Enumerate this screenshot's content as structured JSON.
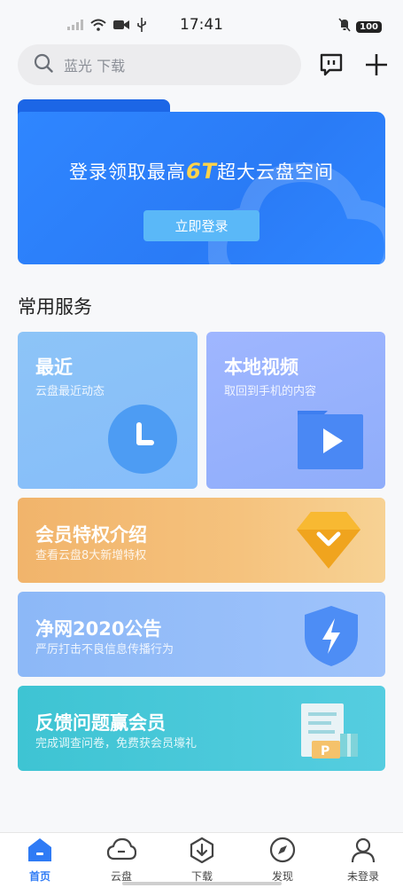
{
  "status_bar": {
    "time": "17:41",
    "battery": "100"
  },
  "search": {
    "placeholder": "蓝光 下载"
  },
  "banner": {
    "title_prefix": "登录领取最高",
    "title_highlight": "6T",
    "title_suffix": "超大云盘空间",
    "login_label": "立即登录"
  },
  "services": {
    "section_title": "常用服务",
    "recent": {
      "title": "最近",
      "subtitle": "云盘最近动态"
    },
    "local_video": {
      "title": "本地视频",
      "subtitle": "取回到手机的内容"
    },
    "vip": {
      "title": "会员特权介绍",
      "subtitle": "查看云盘8大新增特权"
    },
    "clean_net": {
      "title": "净网2020公告",
      "subtitle": "严厉打击不良信息传播行为"
    },
    "feedback": {
      "title": "反馈问题赢会员",
      "subtitle": "完成调查问卷，免费获会员壕礼"
    }
  },
  "nav": {
    "items": [
      {
        "label": "首页",
        "icon": "home-icon",
        "active": true
      },
      {
        "label": "云盘",
        "icon": "cloud-icon",
        "active": false
      },
      {
        "label": "下载",
        "icon": "download-icon",
        "active": false
      },
      {
        "label": "发现",
        "icon": "compass-icon",
        "active": false
      },
      {
        "label": "未登录",
        "icon": "user-icon",
        "active": false
      }
    ]
  },
  "colors": {
    "accent": "#2f7bf5",
    "banner": "#2a7bf6",
    "highlight": "#ffd34a"
  }
}
